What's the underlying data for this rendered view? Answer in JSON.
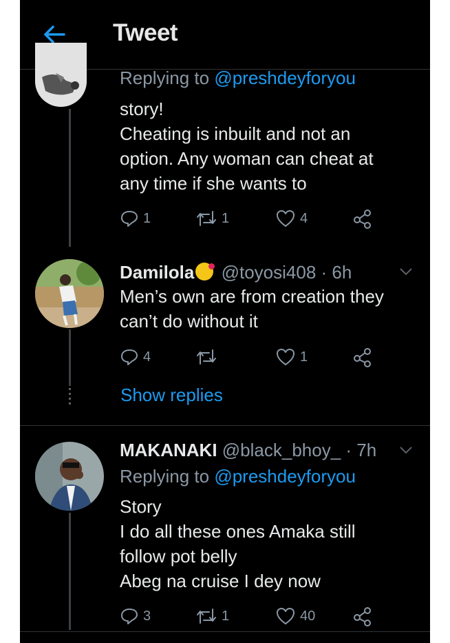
{
  "header": {
    "title": "Tweet"
  },
  "tweets": [
    {
      "replying_prefix": "Replying to",
      "replying_handle": "@preshdeyforyou",
      "lines": [
        "story!",
        "Cheating is inbuilt and not an",
        "option. Any woman can cheat at",
        "any time if she wants to"
      ],
      "reply_count": "1",
      "retweet_count": "1",
      "like_count": "4"
    },
    {
      "name": "Damilola",
      "handle": "@toyosi408",
      "time": "· 6h",
      "lines": [
        "Men’s own are from creation they",
        "can’t do without it"
      ],
      "reply_count": "4",
      "retweet_count": "",
      "like_count": "1",
      "show_replies": "Show replies"
    },
    {
      "name": "MAKANAKI",
      "handle": "@black_bhoy_",
      "time": "· 7h",
      "replying_prefix": "Replying to",
      "replying_handle": "@preshdeyforyou",
      "lines": [
        "Story",
        "I do all these ones Amaka still",
        "follow pot belly",
        "Abeg na cruise I dey now"
      ],
      "reply_count": "3",
      "retweet_count": "1",
      "like_count": "40"
    }
  ],
  "colors": {
    "background": "#000000",
    "accent": "#1d9bf0",
    "muted": "#8b98a5",
    "text": "#e7e9ea"
  },
  "icons": [
    "back-arrow-icon",
    "reply-icon",
    "retweet-icon",
    "like-icon",
    "share-icon",
    "chevron-down-icon"
  ]
}
